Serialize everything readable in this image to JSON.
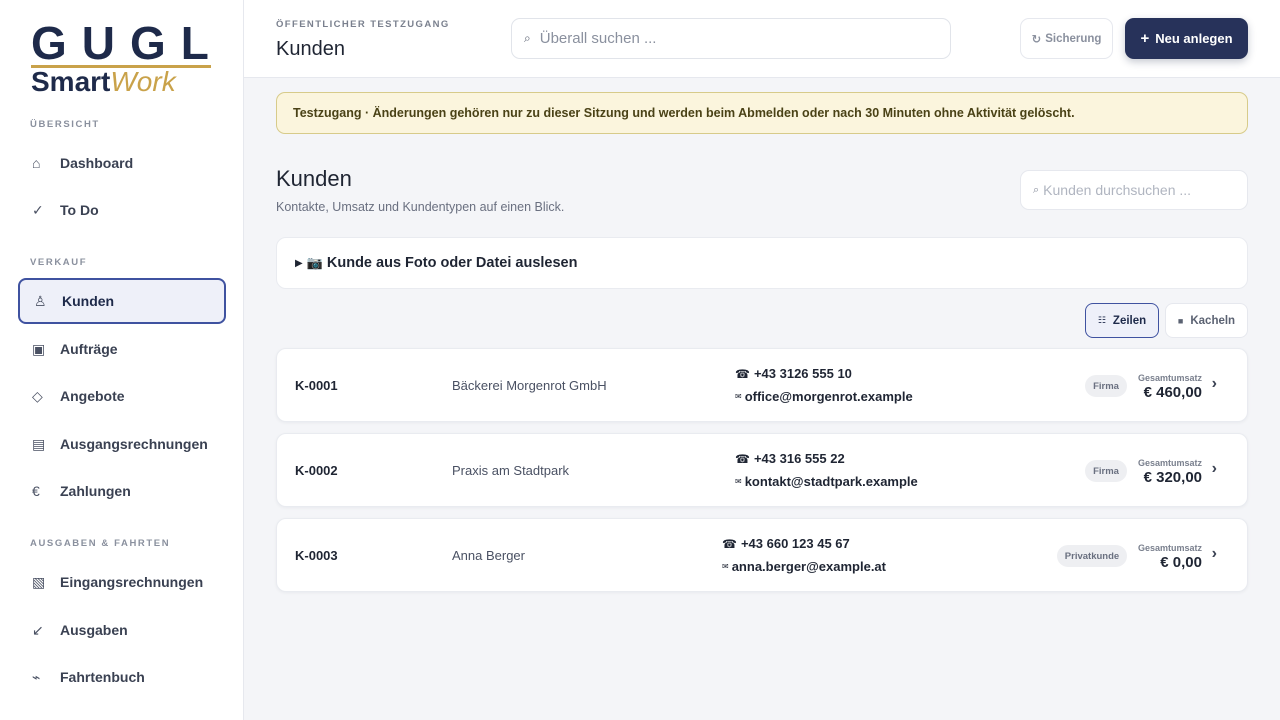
{
  "brand": {
    "top": "GUGL",
    "smart": "Smart",
    "work": "Work",
    "colors": {
      "navy": "#1e2a4a",
      "gold": "#c9a24a"
    }
  },
  "sidebar": {
    "sections": [
      {
        "label": "ÜBERSICHT"
      },
      {
        "label": "VERKAUF"
      },
      {
        "label": "AUSGABEN & FAHRTEN"
      }
    ],
    "items": [
      {
        "label": "Dashboard",
        "icon": "home-icon",
        "glyph": "⌂"
      },
      {
        "label": "To Do",
        "icon": "check-icon",
        "glyph": "✓"
      },
      {
        "label": "Kunden",
        "icon": "person-icon",
        "glyph": "♙",
        "active": true
      },
      {
        "label": "Aufträge",
        "icon": "order-icon",
        "glyph": "▣"
      },
      {
        "label": "Angebote",
        "icon": "diamond-icon",
        "glyph": "◇"
      },
      {
        "label": "Ausgangsrechnungen",
        "icon": "invoice-icon",
        "glyph": "▤"
      },
      {
        "label": "Zahlungen",
        "icon": "euro-icon",
        "glyph": "€"
      },
      {
        "label": "Eingangsrechnungen",
        "icon": "incoming-invoice-icon",
        "glyph": "▧"
      },
      {
        "label": "Ausgaben",
        "icon": "arrow-down-left-icon",
        "glyph": "↙"
      },
      {
        "label": "Fahrtenbuch",
        "icon": "route-icon",
        "glyph": "⌁"
      }
    ]
  },
  "header": {
    "eyebrow": "ÖFFENTLICHER TESTZUGANG",
    "title": "Kunden",
    "search_placeholder": "Überall suchen ...",
    "backup_label": "Sicherung",
    "new_label": "Neu anlegen"
  },
  "banner": {
    "text": "Testzugang · Änderungen gehören nur zu dieser Sitzung und werden beim Abmelden oder nach 30 Minuten ohne Aktivität gelöscht."
  },
  "page": {
    "title": "Kunden",
    "subtitle": "Kontakte, Umsatz und Kundentypen auf einen Blick.",
    "filter_placeholder": "Kunden durchsuchen ...",
    "import_label": "Kunde aus Foto oder Datei auslesen",
    "view_rows": "Zeilen",
    "view_tiles": "Kacheln"
  },
  "customers": [
    {
      "id": "K-0001",
      "name": "Bäckerei Morgenrot GmbH",
      "phone": "+43 3126 555 10",
      "email": "office@morgenrot.example",
      "type": "Firma",
      "total_label": "Gesamtumsatz",
      "total": "€ 460,00"
    },
    {
      "id": "K-0002",
      "name": "Praxis am Stadtpark",
      "phone": "+43 316 555 22",
      "email": "kontakt@stadtpark.example",
      "type": "Firma",
      "total_label": "Gesamtumsatz",
      "total": "€ 320,00"
    },
    {
      "id": "K-0003",
      "name": "Anna Berger",
      "phone": "+43 660 123 45 67",
      "email": "anna.berger@example.at",
      "type": "Privatkunde",
      "total_label": "Gesamtumsatz",
      "total": "€ 0,00"
    }
  ]
}
